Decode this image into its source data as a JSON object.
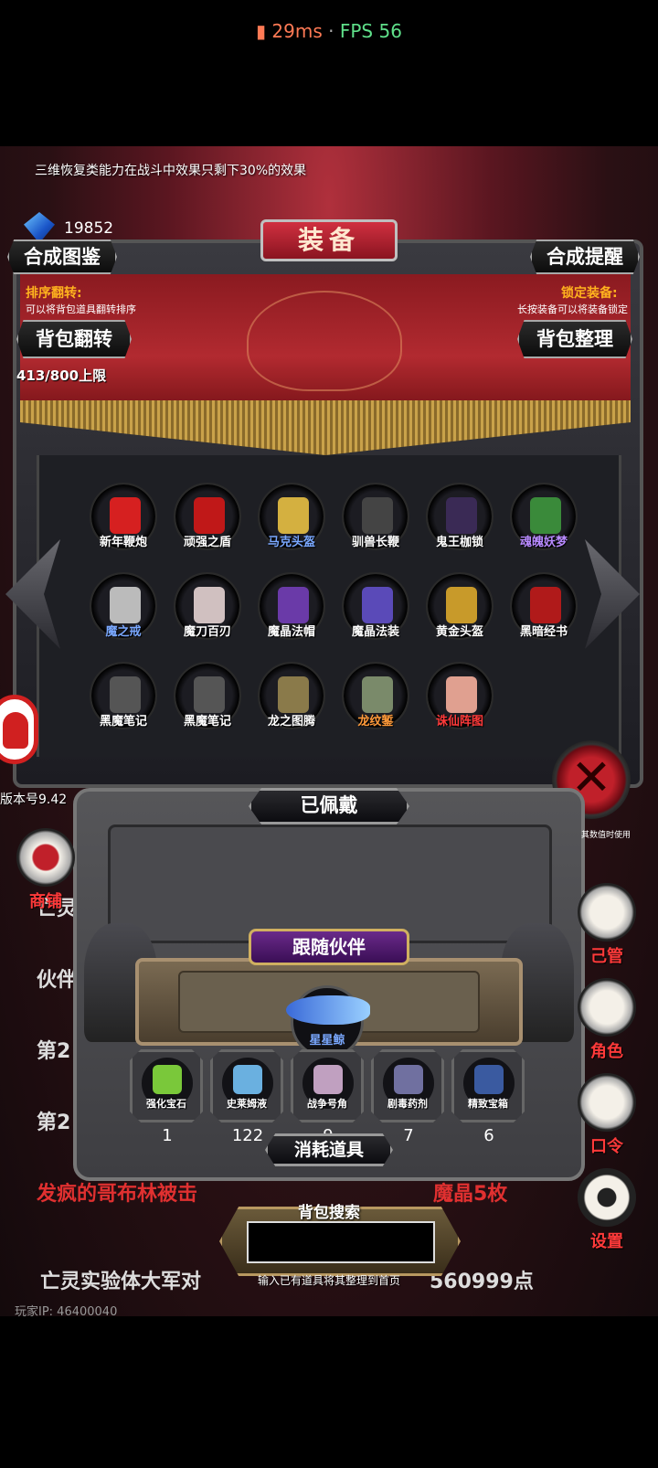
{
  "status_bar": {
    "latency": "29ms",
    "separator": "·",
    "fps": "FPS 56"
  },
  "notice": "三维恢复类能力在战斗中效果只剩下30%的效果",
  "currency": {
    "amount": "19852"
  },
  "header": {
    "title": "装备",
    "left_button": "合成图鉴",
    "right_button": "合成提醒"
  },
  "hints": {
    "left_title": "排序翻转:",
    "left_sub": "可以将背包道具翻转排序",
    "right_title": "锁定装备:",
    "right_sub": "长按装备可以将装备锁定"
  },
  "buttons": {
    "flip": "背包翻转",
    "sort": "背包整理"
  },
  "capacity": "413/800上限",
  "items": [
    {
      "label": "新年鞭炮",
      "color": "#ffffff",
      "icon_color": "#d62020"
    },
    {
      "label": "顽强之盾",
      "color": "#ffffff",
      "icon_color": "#c01818"
    },
    {
      "label": "马克头盔",
      "color": "#7aa8ff",
      "icon_color": "#d4b040"
    },
    {
      "label": "驯兽长鞭",
      "color": "#ffffff",
      "icon_color": "#444444"
    },
    {
      "label": "鬼王枷锁",
      "color": "#ffffff",
      "icon_color": "#3a2a55"
    },
    {
      "label": "魂魄妖梦",
      "color": "#b88aff",
      "icon_color": "#3a8a3a"
    },
    {
      "label": "魔之戒",
      "color": "#7aa8ff",
      "icon_color": "#bbbbbb"
    },
    {
      "label": "魔刀百刃",
      "color": "#ffffff",
      "icon_color": "#d0c0c0"
    },
    {
      "label": "魔晶法帽",
      "color": "#ffffff",
      "icon_color": "#6a3aa8"
    },
    {
      "label": "魔晶法装",
      "color": "#ffffff",
      "icon_color": "#5a4ab8"
    },
    {
      "label": "黄金头盔",
      "color": "#ffffff",
      "icon_color": "#c89a2a"
    },
    {
      "label": "黑暗经书",
      "color": "#ffffff",
      "icon_color": "#b01a1a"
    },
    {
      "label": "黑魔笔记",
      "color": "#ffffff",
      "icon_color": "#555555"
    },
    {
      "label": "黑魔笔记",
      "color": "#ffffff",
      "icon_color": "#555555"
    },
    {
      "label": "龙之图腾",
      "color": "#ffffff",
      "icon_color": "#8a7a4a"
    },
    {
      "label": "龙纹錾",
      "color": "#ff9a3a",
      "icon_color": "#7a8a6a"
    },
    {
      "label": "诛仙阵图",
      "color": "#ff3a3a",
      "icon_color": "#e0a090"
    }
  ],
  "version": "版本号9.42",
  "equipped": {
    "title": "已佩戴"
  },
  "partner": {
    "title": "跟随伙伴",
    "name": "星星鲸"
  },
  "consumables": [
    {
      "label": "强化宝石",
      "count": "1",
      "icon_color": "#7ac83a"
    },
    {
      "label": "史莱姆液",
      "count": "122",
      "icon_color": "#6ab0e0"
    },
    {
      "label": "战争号角",
      "count": "9",
      "icon_color": "#c0a0c0"
    },
    {
      "label": "剧毒药剂",
      "count": "7",
      "icon_color": "#7070a0"
    },
    {
      "label": "精致宝箱",
      "count": "6",
      "icon_color": "#3a5aa0"
    }
  ],
  "consumables_title": "消耗道具",
  "search": {
    "title": "背包搜索",
    "hint": "输入已有道具将其整理到首页"
  },
  "side_menu": {
    "shop": "商铺",
    "manage": "己管",
    "role": "角色",
    "password": "口令",
    "settings": "设置",
    "top_text": "其数值时使用"
  },
  "log_lines": [
    {
      "text": "亡灵",
      "color": "grey"
    },
    {
      "text": "伙伴",
      "color": "grey"
    },
    {
      "text": "第2",
      "color": "grey"
    },
    {
      "text": "第2",
      "color": "grey"
    },
    {
      "text": "发疯的哥布林被击",
      "color": "red"
    },
    {
      "text": "亡灵实验体大军对",
      "color": "grey"
    }
  ],
  "log_tail": {
    "red_tail": "魔晶5枚",
    "grey_tail": "560999点"
  },
  "player_ip": "玩家IP: 46400040"
}
